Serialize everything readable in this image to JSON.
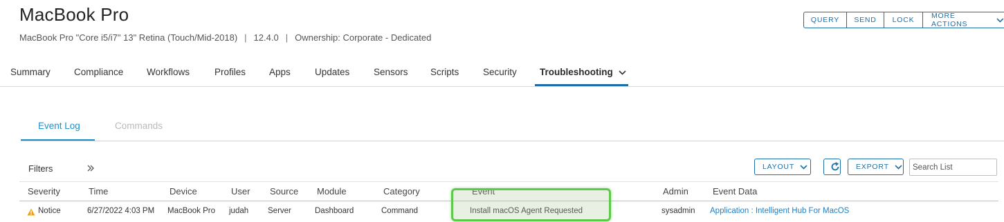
{
  "header": {
    "title": "MacBook Pro",
    "model": "MacBook Pro \"Core i5/i7\" 13\" Retina (Touch/Mid-2018)",
    "os_version": "12.4.0",
    "ownership": "Ownership: Corporate - Dedicated",
    "separator": "|"
  },
  "actions": {
    "query": "QUERY",
    "send": "SEND",
    "lock": "LOCK",
    "more": "MORE ACTIONS"
  },
  "main_tabs": [
    {
      "label": "Summary"
    },
    {
      "label": "Compliance"
    },
    {
      "label": "Workflows"
    },
    {
      "label": "Profiles"
    },
    {
      "label": "Apps"
    },
    {
      "label": "Updates"
    },
    {
      "label": "Sensors"
    },
    {
      "label": "Scripts"
    },
    {
      "label": "Security"
    },
    {
      "label": "Troubleshooting",
      "active": true
    }
  ],
  "sub_tabs": [
    {
      "label": "Event Log",
      "active": true
    },
    {
      "label": "Commands",
      "active": false
    }
  ],
  "toolbar": {
    "filters_label": "Filters",
    "layout_label": "LAYOUT",
    "export_label": "EXPORT",
    "search_placeholder": "Search List"
  },
  "table": {
    "columns": [
      "Severity",
      "Time",
      "Device",
      "User",
      "Source",
      "Module",
      "Category",
      "Event",
      "Admin",
      "Event Data"
    ],
    "rows": [
      {
        "severity": "Notice",
        "time": "6/27/2022 4:03 PM",
        "device": "MacBook Pro",
        "user": "judah",
        "source": "Server",
        "module": "Dashboard",
        "category": "Command",
        "event": "Install macOS Agent Requested",
        "admin": "sysadmin",
        "event_data": "Application : Intelligent Hub For MacOS"
      }
    ]
  },
  "colors": {
    "accent": "#1b6fa8",
    "active_subtab": "#1f8fc4",
    "warning": "#f0a30a",
    "highlight": "#5cc94a"
  },
  "icons": {
    "more_actions": "chevron-down-icon",
    "active_tab": "chevron-down-icon",
    "filters_expand": "double-chevron-right-icon",
    "refresh": "refresh-icon",
    "severity": "warning-icon"
  }
}
